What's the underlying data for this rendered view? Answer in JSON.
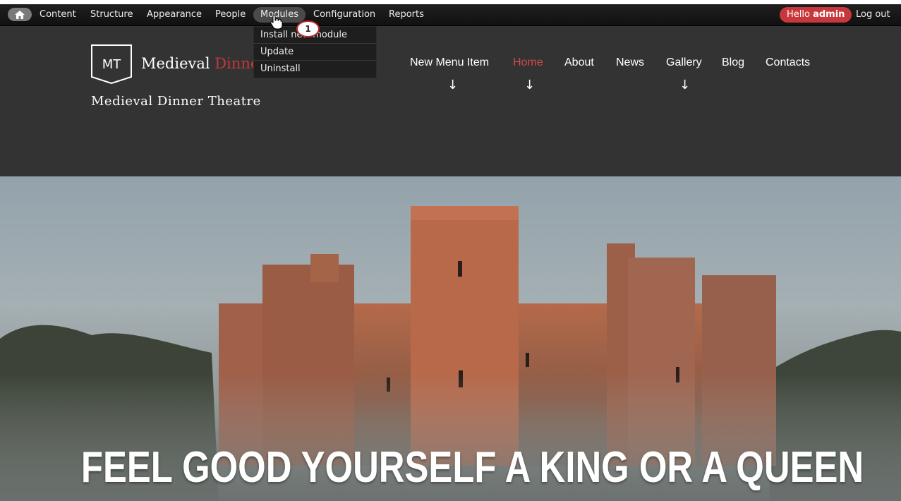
{
  "admin_bar": {
    "items": [
      {
        "label": "Content"
      },
      {
        "label": "Structure"
      },
      {
        "label": "Appearance"
      },
      {
        "label": "People"
      },
      {
        "label": "Modules"
      },
      {
        "label": "Configuration"
      },
      {
        "label": "Reports"
      }
    ],
    "hello_prefix": "Hello",
    "hello_user": "admin",
    "logout": "Log out"
  },
  "modules_dropdown": {
    "items": [
      {
        "label": "Install new module"
      },
      {
        "label": "Update"
      },
      {
        "label": "Uninstall"
      }
    ]
  },
  "step_badge": "1",
  "site": {
    "logo_mark": "MT",
    "logo_name_white": "Medieval ",
    "logo_name_red": "Dinner Theatre",
    "slogan": "Medieval Dinner Theatre"
  },
  "main_nav": {
    "items": [
      {
        "label": "New Menu Item"
      },
      {
        "label": "Home"
      },
      {
        "label": "About"
      },
      {
        "label": "News"
      },
      {
        "label": "Gallery"
      },
      {
        "label": "Blog"
      },
      {
        "label": "Contacts"
      }
    ],
    "active": "Home",
    "arrow": "↓"
  },
  "hero": {
    "title": "FEEL GOOD YOURSELF A KING OR A QUEEN"
  },
  "colors": {
    "accent_red": "#c7373b",
    "nav_active": "#d04a4a",
    "header_bg": "#333333"
  }
}
